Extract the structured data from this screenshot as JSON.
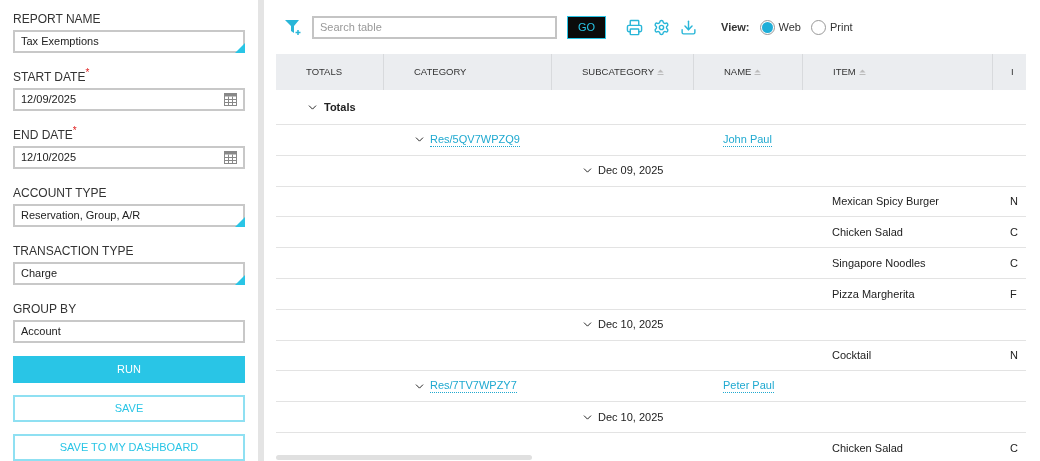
{
  "form": {
    "fields": [
      {
        "label": "REPORT NAME",
        "kind": "select",
        "value": "Tax Exemptions"
      },
      {
        "label": "START DATE",
        "required_mark": "*",
        "kind": "date",
        "value": "12/09/2025"
      },
      {
        "label": "END DATE",
        "required_mark": "*",
        "kind": "date",
        "value": "12/10/2025"
      },
      {
        "label": "ACCOUNT TYPE",
        "kind": "select",
        "value": "Reservation, Group, A/R"
      },
      {
        "label": "TRANSACTION TYPE",
        "kind": "select",
        "value": "Charge"
      },
      {
        "label": "GROUP BY",
        "kind": "text",
        "value": "Account"
      }
    ],
    "buttons": [
      {
        "label": "RUN",
        "kind": "primary"
      },
      {
        "label": "SAVE",
        "kind": "outline"
      },
      {
        "label": "SAVE TO MY DASHBOARD",
        "kind": "outline"
      }
    ]
  },
  "toolbar": {
    "search": {
      "placeholder": "Search table"
    },
    "go_button": "GO",
    "view_label": "View:",
    "view_options": [
      {
        "label": "Web",
        "selected": true
      },
      {
        "label": "Print",
        "selected": false
      }
    ]
  },
  "table": {
    "columns": [
      {
        "label": "TOTALS",
        "sortable": false
      },
      {
        "label": "CATEGORY",
        "sortable": false
      },
      {
        "label": "SUBCATEGORY",
        "sortable": true
      },
      {
        "label": "NAME",
        "sortable": true
      },
      {
        "label": "ITEM",
        "sortable": true
      },
      {
        "label": "I",
        "sortable": false
      }
    ],
    "rows": [
      {
        "kind": "group",
        "label": "Totals",
        "expanded": true,
        "children": [
          {
            "kind": "reservation",
            "category": "Res/5QV7WPZQ9",
            "name": "John Paul",
            "expanded": true,
            "children": [
              {
                "kind": "date",
                "label": "Dec 09, 2025",
                "expanded": true,
                "children": [
                  {
                    "kind": "item",
                    "item": "Mexican Spicy Burger",
                    "column_6": "N"
                  },
                  {
                    "kind": "item",
                    "item": "Chicken Salad",
                    "column_6": "C"
                  },
                  {
                    "kind": "item",
                    "item": "Singapore Noodles",
                    "column_6": "C"
                  },
                  {
                    "kind": "item",
                    "item": "Pizza Margherita",
                    "column_6": "F"
                  }
                ]
              },
              {
                "kind": "date",
                "label": "Dec 10, 2025",
                "expanded": true,
                "children": [
                  {
                    "kind": "item",
                    "item": "Cocktail",
                    "column_6": "N"
                  }
                ]
              }
            ]
          },
          {
            "kind": "reservation",
            "category": "Res/7TV7WPZY7",
            "name": "Peter Paul",
            "expanded": true,
            "children": [
              {
                "kind": "date",
                "label": "Dec 10, 2025",
                "expanded": true,
                "children": [
                  {
                    "kind": "item",
                    "item": "Chicken Salad",
                    "column_6": "C"
                  }
                ]
              }
            ]
          }
        ]
      }
    ]
  }
}
